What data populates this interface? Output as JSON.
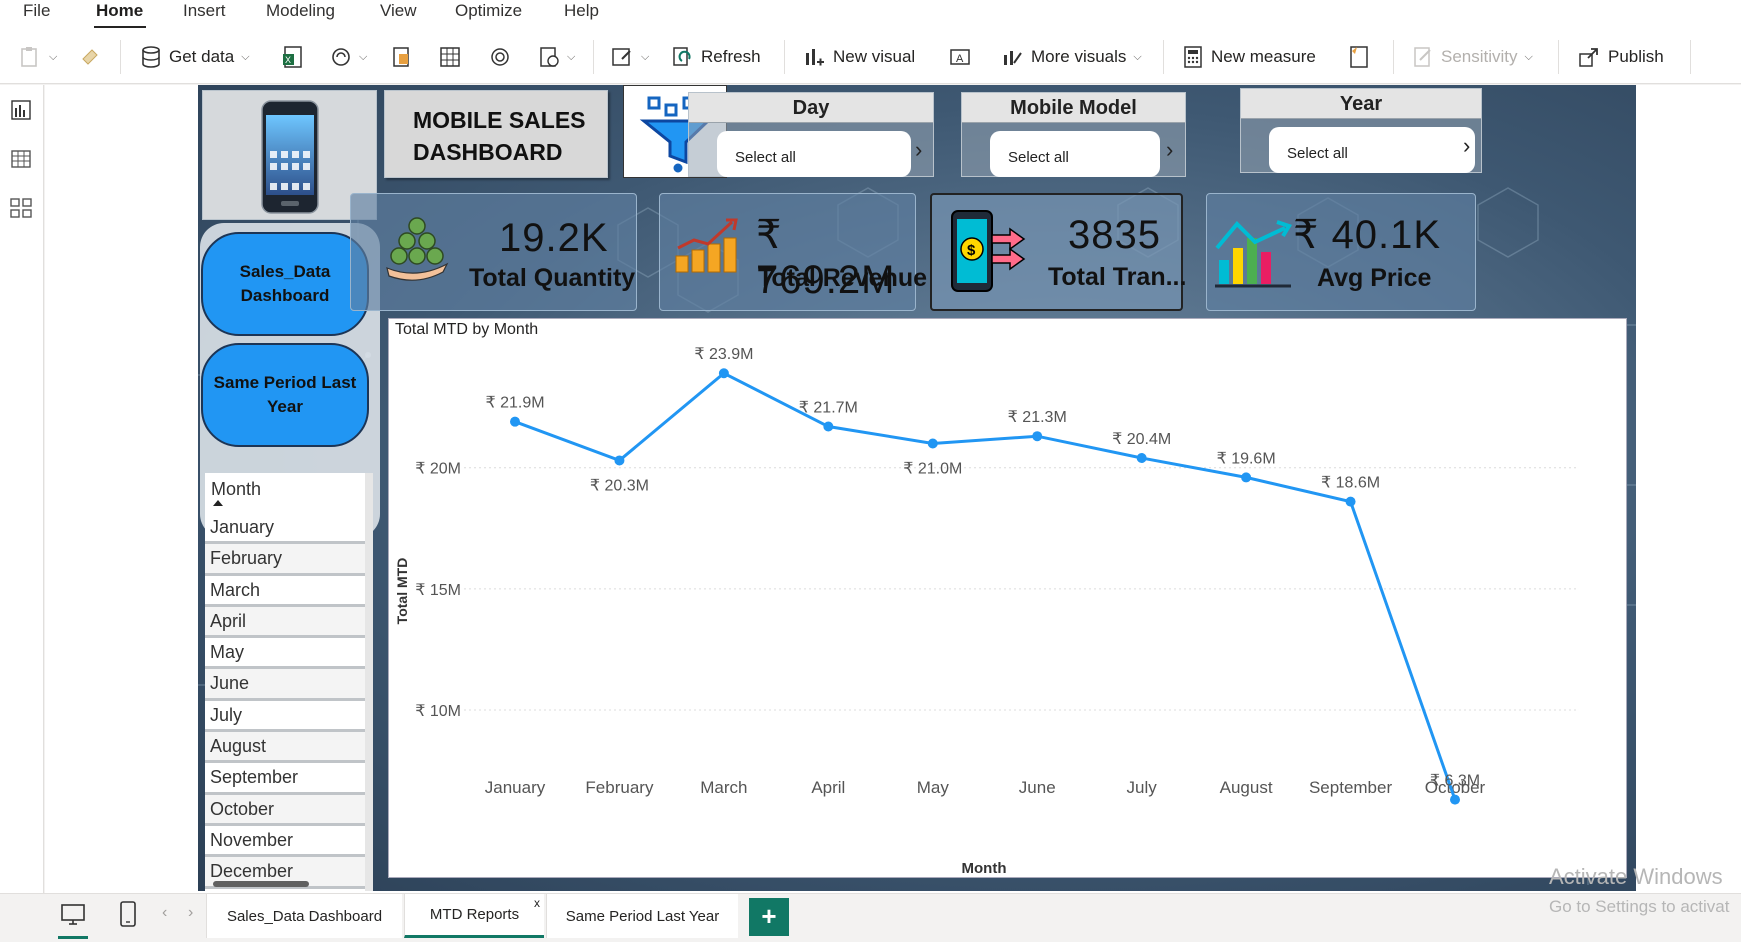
{
  "menu": {
    "items": [
      "File",
      "Home",
      "Insert",
      "Modeling",
      "View",
      "Optimize",
      "Help"
    ],
    "active": "Home"
  },
  "ribbon": {
    "get_data": "Get data",
    "refresh": "Refresh",
    "new_visual": "New visual",
    "more_visuals": "More visuals",
    "new_measure": "New measure",
    "sensitivity": "Sensitivity",
    "publish": "Publish"
  },
  "report": {
    "title_line1": "MOBILE SALES",
    "title_line2": "DASHBOARD",
    "slicers": {
      "day": {
        "title": "Day",
        "value": "Select all"
      },
      "mobile_model": {
        "title": "Mobile Model",
        "value": "Select all"
      },
      "year": {
        "title": "Year",
        "value": "Select all"
      }
    },
    "nav": {
      "sales_data_line1": "Sales_Data",
      "sales_data_line2": "Dashboard",
      "same_period_line1": "Same Period Last",
      "same_period_line2": "Year"
    },
    "kpis": {
      "quantity": {
        "value": "19.2K",
        "label": "Total Quantity"
      },
      "revenue": {
        "value": "₹ 769.2M",
        "label": "Total Revenue"
      },
      "transactions": {
        "value": "3835",
        "label": "Total Tran..."
      },
      "avg_price": {
        "value": "₹ 40.1K",
        "label": "Avg Price"
      }
    },
    "month_slicer": {
      "header": "Month",
      "items": [
        "January",
        "February",
        "March",
        "April",
        "May",
        "June",
        "July",
        "August",
        "September",
        "October",
        "November",
        "December"
      ]
    }
  },
  "chart_data": {
    "type": "line",
    "title": "Total MTD by Month",
    "xlabel": "Month",
    "ylabel": "Total MTD",
    "categories": [
      "January",
      "February",
      "March",
      "April",
      "May",
      "June",
      "July",
      "August",
      "September",
      "October"
    ],
    "values": [
      21.9,
      20.3,
      23.9,
      21.7,
      21.0,
      21.3,
      20.4,
      19.6,
      18.6,
      6.3
    ],
    "data_labels": [
      "₹ 21.9M",
      "₹ 20.3M",
      "₹ 23.9M",
      "₹ 21.7M",
      "₹ 21.0M",
      "₹ 21.3M",
      "₹ 20.4M",
      "₹ 19.6M",
      "₹ 18.6M",
      "₹ 6.3M"
    ],
    "y_ticks": [
      10,
      15,
      20
    ],
    "y_tick_labels": [
      "₹ 10M",
      "₹ 15M",
      "₹ 20M"
    ],
    "ylim": [
      5.5,
      24.9
    ],
    "grid": true,
    "color": "#2196f3"
  },
  "pages": {
    "tabs": [
      "Sales_Data Dashboard",
      "MTD Reports",
      "Same Period Last Year"
    ],
    "active": "MTD Reports",
    "add_label": "+"
  },
  "watermark": {
    "line1": "Activate Windows",
    "line2": "Go to Settings to activat"
  }
}
